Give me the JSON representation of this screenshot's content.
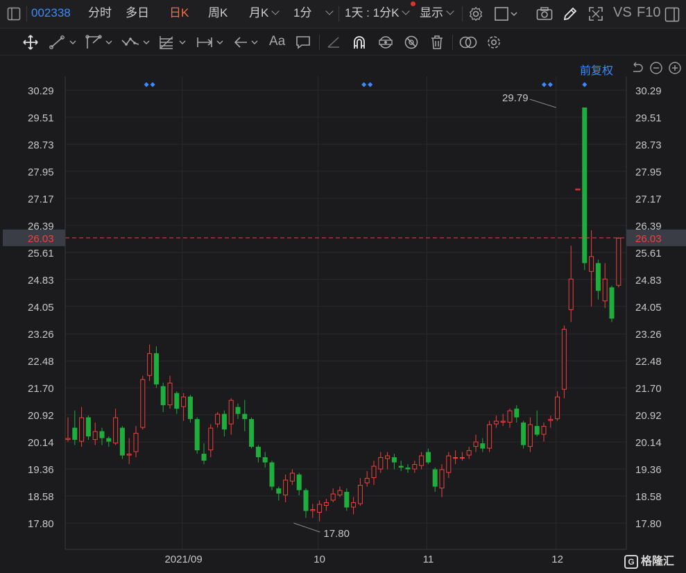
{
  "topbar": {
    "code": "002338",
    "tab_fenshi": "分时",
    "tab_duori": "多日",
    "tab_rik": "日K",
    "tab_zhouk": "周K",
    "tab_yuek": "月K",
    "tab_1fen": "1分",
    "tab_1tian": "1天 : 1分K",
    "tab_xianshi": "显示",
    "vs_label": "VS",
    "f10_label": "F10"
  },
  "toolbar": {
    "text_tool": "Aa"
  },
  "chart_header": {
    "adjust_label": "前复权"
  },
  "watermark": {
    "brand": "格隆汇"
  },
  "colors": {
    "up": "#f0413c",
    "down": "#1fae3d",
    "current_price": "#f0413c",
    "accent": "#3d8bff"
  },
  "chart_data": {
    "type": "candlestick",
    "x_labels": [
      "2021/09",
      "10",
      "11",
      "12"
    ],
    "x_label_bar_index": [
      17,
      37,
      53,
      72
    ],
    "y_ticks": [
      30.29,
      29.51,
      28.73,
      27.95,
      27.17,
      26.39,
      25.61,
      24.83,
      24.05,
      23.26,
      22.48,
      21.7,
      20.92,
      20.14,
      19.36,
      18.58,
      17.8
    ],
    "y_tick_labels": [
      "30.29",
      "29.51",
      "28.73",
      "27.95",
      "27.17",
      "26.39",
      "25.61",
      "24.83",
      "24.05",
      "23.26",
      "22.48",
      "21.70",
      "20.92",
      "20.14",
      "19.36",
      "18.58",
      "17.80"
    ],
    "ylim": [
      17.02,
      30.29
    ],
    "current_price": 26.03,
    "current_price_label": "26.03",
    "annotations": [
      {
        "label": "29.79",
        "bar_index": 72,
        "value": 29.79,
        "side": "left",
        "type": "high"
      },
      {
        "label": "17.80",
        "bar_index": 33,
        "value": 17.8,
        "side": "right",
        "type": "low"
      }
    ],
    "event_marks": [
      {
        "bar_index": 12,
        "count": 2
      },
      {
        "bar_index": 44,
        "count": 2
      },
      {
        "bar_index": 70.5,
        "count": 2
      },
      {
        "bar_index": 76,
        "count": 1
      }
    ],
    "candles": [
      [
        20.2,
        20.25,
        20.15,
        20.85
      ],
      [
        20.55,
        20.2,
        20.05,
        21.05
      ],
      [
        20.15,
        20.85,
        20.0,
        21.15
      ],
      [
        20.85,
        20.3,
        20.2,
        20.9
      ],
      [
        20.2,
        20.45,
        20.05,
        20.7
      ],
      [
        20.45,
        20.25,
        20.05,
        20.55
      ],
      [
        20.25,
        20.15,
        20.0,
        20.3
      ],
      [
        20.1,
        20.85,
        20.05,
        21.1
      ],
      [
        20.55,
        19.75,
        19.65,
        20.6
      ],
      [
        19.75,
        19.8,
        19.5,
        20.25
      ],
      [
        19.85,
        20.4,
        19.7,
        20.6
      ],
      [
        20.55,
        21.95,
        20.5,
        22.05
      ],
      [
        22.05,
        22.7,
        21.9,
        22.95
      ],
      [
        22.7,
        21.8,
        21.7,
        22.9
      ],
      [
        21.75,
        21.2,
        21.0,
        21.85
      ],
      [
        21.2,
        21.85,
        21.1,
        22.05
      ],
      [
        21.55,
        21.1,
        20.95,
        21.6
      ],
      [
        21.15,
        21.45,
        20.75,
        21.55
      ],
      [
        21.45,
        20.8,
        20.7,
        21.5
      ],
      [
        20.8,
        19.9,
        19.8,
        20.85
      ],
      [
        19.8,
        19.6,
        19.5,
        20.1
      ],
      [
        19.9,
        20.55,
        19.7,
        20.65
      ],
      [
        20.65,
        20.95,
        20.55,
        21.0
      ],
      [
        20.95,
        20.5,
        20.3,
        21.05
      ],
      [
        20.65,
        21.35,
        20.35,
        21.4
      ],
      [
        21.15,
        20.95,
        20.8,
        21.25
      ],
      [
        20.95,
        20.8,
        20.45,
        21.35
      ],
      [
        20.8,
        20.0,
        19.95,
        20.85
      ],
      [
        20.0,
        19.7,
        19.55,
        20.05
      ],
      [
        19.7,
        19.55,
        19.4,
        19.85
      ],
      [
        19.55,
        18.85,
        18.75,
        19.6
      ],
      [
        18.8,
        18.65,
        18.45,
        18.85
      ],
      [
        18.6,
        19.05,
        18.4,
        19.2
      ],
      [
        19.0,
        19.25,
        18.9,
        19.35
      ],
      [
        19.2,
        18.75,
        18.6,
        19.25
      ],
      [
        18.75,
        18.15,
        17.95,
        18.8
      ],
      [
        18.15,
        18.2,
        17.95,
        18.35
      ],
      [
        18.1,
        18.35,
        17.85,
        18.45
      ],
      [
        18.3,
        18.4,
        18.15,
        18.5
      ],
      [
        18.45,
        18.65,
        18.4,
        18.8
      ],
      [
        18.6,
        18.75,
        18.55,
        18.85
      ],
      [
        18.7,
        18.25,
        18.15,
        18.8
      ],
      [
        18.25,
        18.4,
        18.05,
        18.55
      ],
      [
        18.35,
        18.9,
        18.3,
        19.1
      ],
      [
        18.95,
        19.1,
        18.85,
        19.3
      ],
      [
        19.1,
        19.45,
        18.9,
        19.6
      ],
      [
        19.35,
        19.7,
        19.25,
        19.85
      ],
      [
        19.65,
        19.75,
        19.35,
        19.85
      ],
      [
        19.7,
        19.55,
        19.35,
        19.8
      ],
      [
        19.45,
        19.4,
        19.3,
        19.6
      ],
      [
        19.4,
        19.35,
        19.25,
        19.5
      ],
      [
        19.35,
        19.5,
        19.25,
        19.6
      ],
      [
        19.45,
        19.75,
        19.35,
        19.85
      ],
      [
        19.85,
        19.55,
        19.5,
        19.95
      ],
      [
        19.35,
        18.85,
        18.7,
        19.4
      ],
      [
        18.8,
        19.35,
        18.55,
        19.5
      ],
      [
        19.25,
        19.75,
        19.1,
        19.85
      ],
      [
        19.7,
        19.7,
        19.5,
        19.9
      ],
      [
        19.7,
        19.7,
        19.6,
        19.85
      ],
      [
        19.75,
        19.9,
        19.65,
        20.0
      ],
      [
        20.0,
        20.15,
        19.85,
        20.35
      ],
      [
        20.1,
        19.95,
        19.85,
        20.25
      ],
      [
        19.95,
        20.65,
        19.85,
        20.75
      ],
      [
        20.65,
        20.75,
        20.55,
        20.9
      ],
      [
        20.7,
        20.75,
        20.6,
        20.95
      ],
      [
        20.7,
        21.05,
        20.55,
        21.1
      ],
      [
        21.1,
        20.85,
        20.7,
        21.2
      ],
      [
        20.7,
        20.05,
        19.95,
        20.75
      ],
      [
        20.0,
        20.65,
        19.85,
        20.85
      ],
      [
        20.6,
        20.35,
        20.3,
        21.05
      ],
      [
        20.35,
        20.6,
        20.15,
        20.7
      ],
      [
        20.75,
        20.8,
        20.55,
        20.9
      ],
      [
        20.8,
        21.45,
        20.75,
        21.6
      ],
      [
        21.65,
        23.4,
        21.4,
        23.5
      ],
      [
        23.95,
        24.85,
        23.6,
        25.8
      ],
      [
        27.4,
        27.45,
        27.4,
        27.45
      ],
      [
        29.79,
        25.3,
        25.1,
        29.79
      ],
      [
        25.05,
        25.5,
        24.05,
        26.25
      ],
      [
        25.3,
        24.5,
        24.25,
        25.4
      ],
      [
        24.2,
        24.85,
        24.0,
        25.3
      ],
      [
        24.6,
        23.7,
        23.6,
        24.65
      ],
      [
        24.65,
        26.03,
        24.6,
        26.05
      ]
    ]
  }
}
